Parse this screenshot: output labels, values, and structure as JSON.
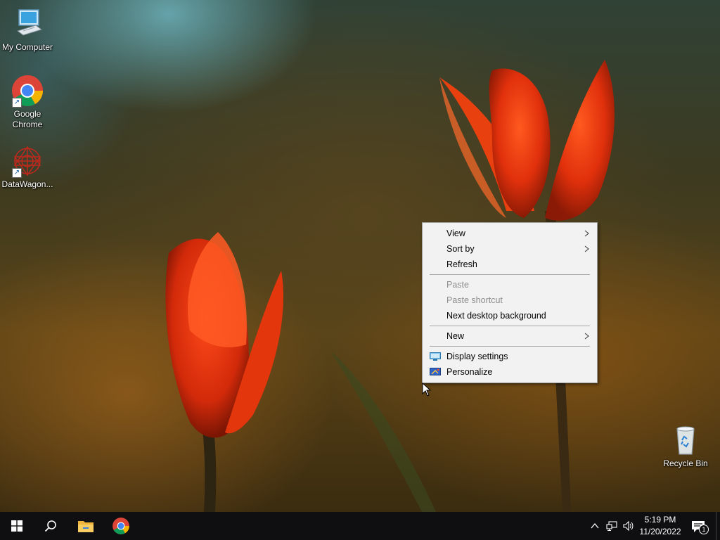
{
  "desktop": {
    "icons": [
      {
        "label": "My Computer",
        "icon": "computer-icon"
      },
      {
        "label": "Google Chrome",
        "icon": "chrome-icon"
      },
      {
        "label": "DataWagon...",
        "icon": "datawagon-icon"
      },
      {
        "label": "Recycle Bin",
        "icon": "recycle-bin-icon"
      }
    ]
  },
  "context_menu": {
    "items": [
      {
        "label": "View",
        "submenu": true,
        "disabled": false
      },
      {
        "label": "Sort by",
        "submenu": true,
        "disabled": false
      },
      {
        "label": "Refresh",
        "submenu": false,
        "disabled": false
      },
      {
        "label": "Paste",
        "submenu": false,
        "disabled": true
      },
      {
        "label": "Paste shortcut",
        "submenu": false,
        "disabled": true
      },
      {
        "label": "Next desktop background",
        "submenu": false,
        "disabled": false
      },
      {
        "label": "New",
        "submenu": true,
        "disabled": false
      },
      {
        "label": "Display settings",
        "submenu": false,
        "disabled": false,
        "icon": "display-settings-icon"
      },
      {
        "label": "Personalize",
        "submenu": false,
        "disabled": false,
        "icon": "personalize-icon"
      }
    ]
  },
  "taskbar": {
    "pinned": [
      {
        "icon": "windows-start-icon"
      },
      {
        "icon": "search-icon"
      },
      {
        "icon": "file-explorer-icon"
      },
      {
        "icon": "chrome-icon"
      }
    ],
    "tray": {
      "icons": [
        "chevron-up-icon",
        "network-icon",
        "volume-icon"
      ],
      "time": "5:19 PM",
      "date": "11/20/2022",
      "notification_count": "1"
    }
  },
  "colors": {
    "taskbar_bg": "#0f0f12",
    "menu_bg": "#f2f2f2",
    "menu_disabled_text": "#8d8d8d",
    "accent_blue": "#1a73e8"
  }
}
